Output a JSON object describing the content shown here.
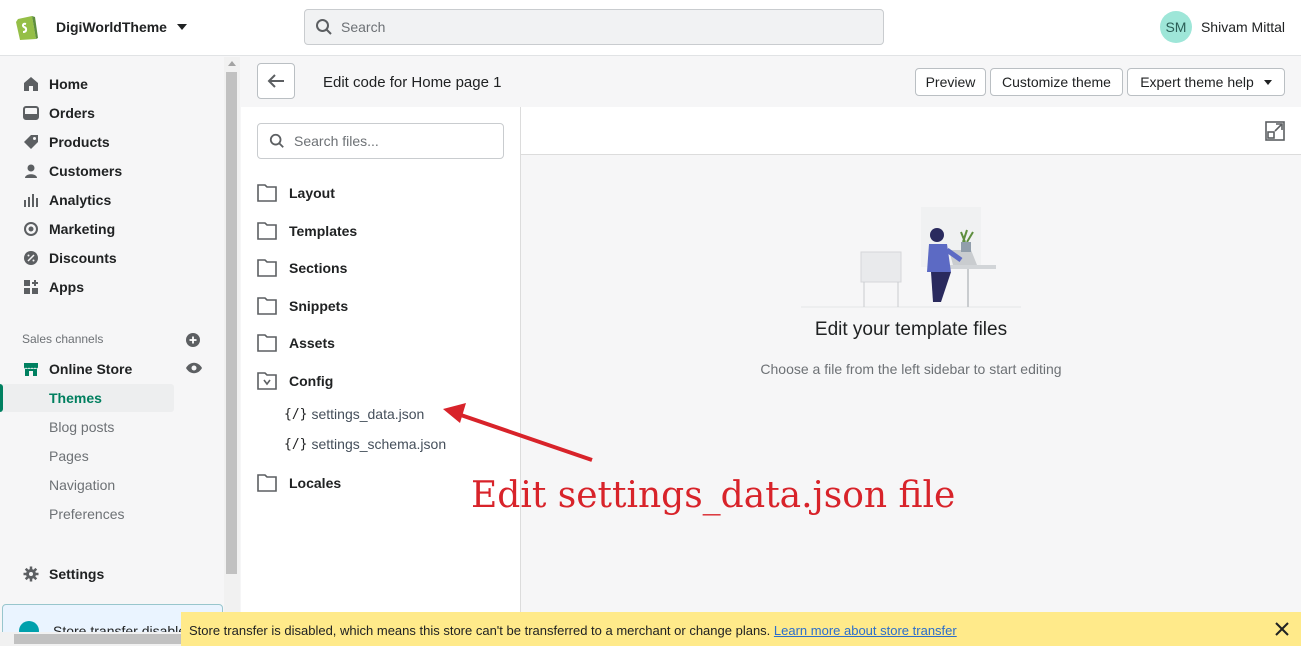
{
  "topbar": {
    "store_name": "DigiWorldTheme",
    "search_placeholder": "Search",
    "user_initials": "SM",
    "user_name": "Shivam Mittal"
  },
  "nav": {
    "items": [
      {
        "label": "Home",
        "icon": "home-icon"
      },
      {
        "label": "Orders",
        "icon": "orders-icon"
      },
      {
        "label": "Products",
        "icon": "tag-icon"
      },
      {
        "label": "Customers",
        "icon": "person-icon"
      },
      {
        "label": "Analytics",
        "icon": "bar-chart-icon"
      },
      {
        "label": "Marketing",
        "icon": "target-icon"
      },
      {
        "label": "Discounts",
        "icon": "discount-icon"
      },
      {
        "label": "Apps",
        "icon": "apps-icon"
      }
    ],
    "sales_channels_title": "Sales channels",
    "online_store": "Online Store",
    "sub_items": [
      "Themes",
      "Blog posts",
      "Pages",
      "Navigation",
      "Preferences"
    ],
    "active_sub": "Themes",
    "settings": "Settings",
    "banner_text": "Store transfer disabled"
  },
  "editor_header": {
    "title_prefix": "Edit code for",
    "title_page": "Home page 1",
    "preview": "Preview",
    "customize": "Customize theme",
    "expert": "Expert theme help"
  },
  "files": {
    "search_placeholder": "Search files...",
    "folders_before": [
      "Layout",
      "Templates",
      "Sections",
      "Snippets",
      "Assets"
    ],
    "open_folder": "Config",
    "config_files": [
      "settings_data.json",
      "settings_schema.json"
    ],
    "file_icon_glyph": "{/}",
    "folders_after": [
      "Locales"
    ]
  },
  "editor": {
    "empty_title": "Edit your template files",
    "empty_subtitle": "Choose a file from the left sidebar to start editing"
  },
  "annotation": {
    "text": "Edit settings_data.json file",
    "color": "#d8232a"
  },
  "transfer_banner": {
    "message": "Store transfer is disabled, which means this store can't be transferred to a merchant or change plans.",
    "link": "Learn more about store transfer"
  },
  "colors": {
    "accent": "#008060",
    "banner_yellow": "#ffea8a"
  }
}
